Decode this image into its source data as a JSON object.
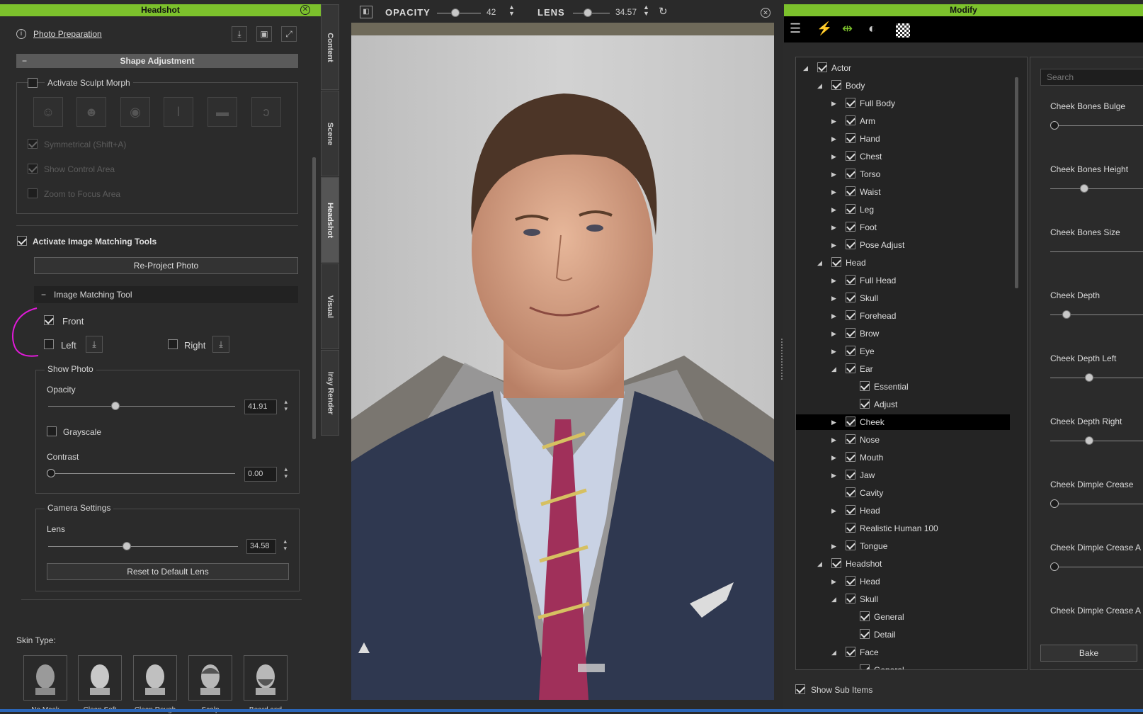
{
  "left_panel": {
    "title": "Headshot",
    "photo_preparation": "Photo Preparation",
    "shape_adjustment": "Shape Adjustment",
    "activate_sculpt_morph": "Activate Sculpt Morph",
    "symmetrical": "Symmetrical (Shift+A)",
    "show_control_area": "Show Control Area",
    "zoom_to_focus": "Zoom to Focus Area",
    "activate_image_matching": "Activate Image Matching Tools",
    "reproject_photo": "Re-Project Photo",
    "image_matching_tool": "Image Matching Tool",
    "front": "Front",
    "left": "Left",
    "right": "Right",
    "show_photo": "Show Photo",
    "opacity_label": "Opacity",
    "opacity_value": "41.91",
    "opacity_level": 0.42,
    "grayscale": "Grayscale",
    "contrast_label": "Contrast",
    "contrast_value": "0.00",
    "camera_settings": "Camera Settings",
    "lens_label": "Lens",
    "lens_value": "34.58",
    "reset_lens": "Reset to Default Lens",
    "skin_type": "Skin Type:",
    "skins": [
      "No Mask",
      "Clean Soft",
      "Clean Rough",
      "Scalp",
      "Beard and"
    ]
  },
  "side_tabs": [
    "Content",
    "Scene",
    "Headshot",
    "Visual",
    "Iray Render"
  ],
  "viewport": {
    "opacity_label": "OPACITY",
    "opacity_value": "42",
    "lens_label": "LENS",
    "lens_value": "34.57"
  },
  "modify": {
    "title": "Modify",
    "search_placeholder": "Search",
    "show_sub_items": "Show Sub Items",
    "bake": "Bake",
    "tree": [
      {
        "label": "Actor",
        "level": 0,
        "arrow": "open"
      },
      {
        "label": "Body",
        "level": 1,
        "arrow": "open"
      },
      {
        "label": "Full Body",
        "level": 2,
        "arrow": "closed"
      },
      {
        "label": "Arm",
        "level": 2,
        "arrow": "closed"
      },
      {
        "label": "Hand",
        "level": 2,
        "arrow": "closed"
      },
      {
        "label": "Chest",
        "level": 2,
        "arrow": "closed"
      },
      {
        "label": "Torso",
        "level": 2,
        "arrow": "closed"
      },
      {
        "label": "Waist",
        "level": 2,
        "arrow": "closed"
      },
      {
        "label": "Leg",
        "level": 2,
        "arrow": "closed"
      },
      {
        "label": "Foot",
        "level": 2,
        "arrow": "closed"
      },
      {
        "label": "Pose Adjust",
        "level": 2,
        "arrow": "closed"
      },
      {
        "label": "Head",
        "level": 1,
        "arrow": "open"
      },
      {
        "label": "Full Head",
        "level": 2,
        "arrow": "closed"
      },
      {
        "label": "Skull",
        "level": 2,
        "arrow": "closed"
      },
      {
        "label": "Forehead",
        "level": 2,
        "arrow": "closed"
      },
      {
        "label": "Brow",
        "level": 2,
        "arrow": "closed"
      },
      {
        "label": "Eye",
        "level": 2,
        "arrow": "closed"
      },
      {
        "label": "Ear",
        "level": 2,
        "arrow": "open"
      },
      {
        "label": "Essential",
        "level": 3,
        "arrow": "none"
      },
      {
        "label": "Adjust",
        "level": 3,
        "arrow": "none"
      },
      {
        "label": "Cheek",
        "level": 2,
        "arrow": "closed",
        "selected": true
      },
      {
        "label": "Nose",
        "level": 2,
        "arrow": "closed"
      },
      {
        "label": "Mouth",
        "level": 2,
        "arrow": "closed"
      },
      {
        "label": "Jaw",
        "level": 2,
        "arrow": "closed"
      },
      {
        "label": "Cavity",
        "level": 2,
        "arrow": "none"
      },
      {
        "label": "Head",
        "level": 2,
        "arrow": "closed"
      },
      {
        "label": "Realistic Human 100",
        "level": 2,
        "arrow": "none"
      },
      {
        "label": "Tongue",
        "level": 2,
        "arrow": "closed"
      },
      {
        "label": "Headshot",
        "level": 1,
        "arrow": "open"
      },
      {
        "label": "Head",
        "level": 2,
        "arrow": "closed"
      },
      {
        "label": "Skull",
        "level": 2,
        "arrow": "open"
      },
      {
        "label": "General",
        "level": 3,
        "arrow": "none"
      },
      {
        "label": "Detail",
        "level": 3,
        "arrow": "none"
      },
      {
        "label": "Face",
        "level": 2,
        "arrow": "open"
      },
      {
        "label": "General",
        "level": 3,
        "arrow": "none"
      }
    ],
    "sliders": [
      {
        "label": "Cheek Bones Bulge",
        "level": 0.0
      },
      {
        "label": "Cheek Bones Height",
        "level": 0.3
      },
      {
        "label": "Cheek Bones Size",
        "level": null
      },
      {
        "label": "Cheek Depth",
        "level": 0.12
      },
      {
        "label": "Cheek Depth Left",
        "level": 0.35
      },
      {
        "label": "Cheek Depth Right",
        "level": 0.35
      },
      {
        "label": "Cheek Dimple Crease",
        "level": 0.0
      },
      {
        "label": "Cheek Dimple Crease A",
        "level": 0.0
      },
      {
        "label": "Cheek Dimple Crease A",
        "level": null
      }
    ]
  }
}
